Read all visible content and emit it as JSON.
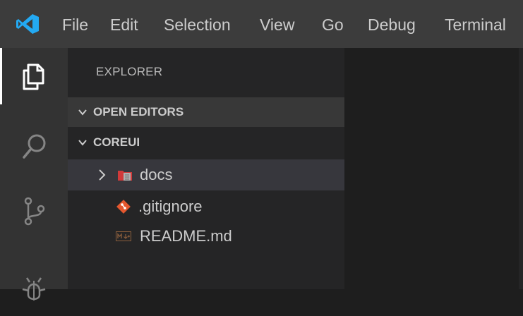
{
  "menubar": {
    "items": [
      "File",
      "Edit",
      "Selection",
      "View",
      "Go",
      "Debug",
      "Terminal"
    ]
  },
  "activitybar": {
    "icons": [
      "explorer-icon",
      "search-icon",
      "source-control-icon",
      "debug-icon"
    ]
  },
  "sidebar": {
    "title": "EXPLORER",
    "sections": {
      "open_editors": "OPEN EDITORS",
      "project": "COREUI"
    },
    "tree": [
      {
        "label": "docs",
        "type": "folder",
        "icon": "folder-docs-icon"
      },
      {
        "label": ".gitignore",
        "type": "file",
        "icon": "git-icon"
      },
      {
        "label": "README.md",
        "type": "file",
        "icon": "markdown-icon"
      }
    ]
  },
  "colors": {
    "menubar": "#3c3c3c",
    "activitybar": "#333333",
    "sidebar": "#252526",
    "selected_row": "#37373d",
    "logo_blue": "#23a9f2",
    "git_orange": "#e4572e",
    "folder_red": "#d13a3a"
  }
}
